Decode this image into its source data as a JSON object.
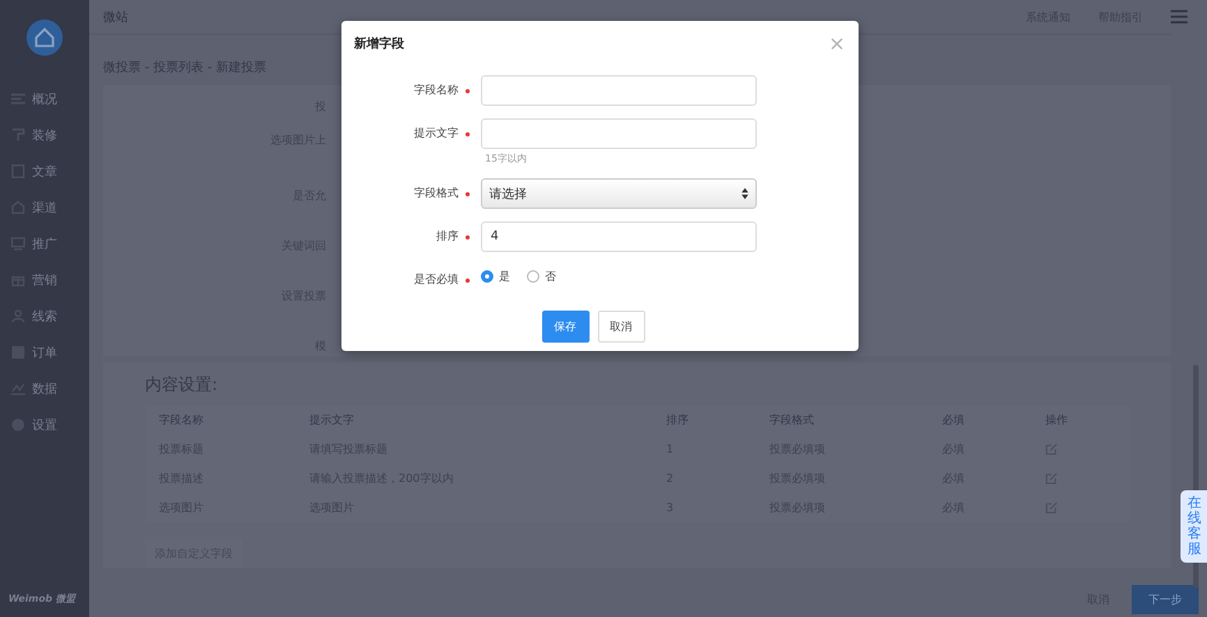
{
  "sidebar": {
    "items": [
      {
        "label": "概况"
      },
      {
        "label": "装修"
      },
      {
        "label": "文章"
      },
      {
        "label": "渠道"
      },
      {
        "label": "推广"
      },
      {
        "label": "营销"
      },
      {
        "label": "线索"
      },
      {
        "label": "订单"
      },
      {
        "label": "数据"
      },
      {
        "label": "设置"
      }
    ],
    "brand": "Weimob 微盟"
  },
  "header": {
    "title": "微站",
    "links": [
      "系统通知",
      "帮助指引"
    ]
  },
  "breadcrumb": "微投票 - 投票列表 - 新建投票",
  "form_labels": [
    "投",
    "选项图片上",
    "是否允",
    "关键词回",
    "设置投票",
    "模"
  ],
  "content": {
    "title": "内容设置:",
    "columns": [
      "字段名称",
      "提示文字",
      "排序",
      "字段格式",
      "必填",
      "操作"
    ],
    "rows": [
      [
        "投票标题",
        "请填写投票标题",
        "1",
        "投票必填项",
        "必填"
      ],
      [
        "投票描述",
        "请输入投票描述，200字以内",
        "2",
        "投票必填项",
        "必填"
      ],
      [
        "选项图片",
        "选项图片",
        "3",
        "投票必填项",
        "必填"
      ]
    ],
    "add_button": "添加自定义字段"
  },
  "footer_buttons": [
    "取消",
    "下一步"
  ],
  "chat_tab": "在线客服",
  "dialog": {
    "title": "新增字段",
    "fields": [
      {
        "kind": "text",
        "label": "字段名称"
      },
      {
        "kind": "text",
        "label": "提示文字",
        "hint": "15字以内"
      },
      {
        "kind": "select",
        "label": "字段格式",
        "value": "请选择"
      },
      {
        "kind": "text",
        "label": "排序",
        "value": "4"
      },
      {
        "kind": "radio",
        "label": "是否必填",
        "options": [
          {
            "label": "是",
            "selected": true
          },
          {
            "label": "否",
            "selected": false
          }
        ]
      }
    ],
    "buttons": [
      "保存",
      "取消"
    ]
  }
}
